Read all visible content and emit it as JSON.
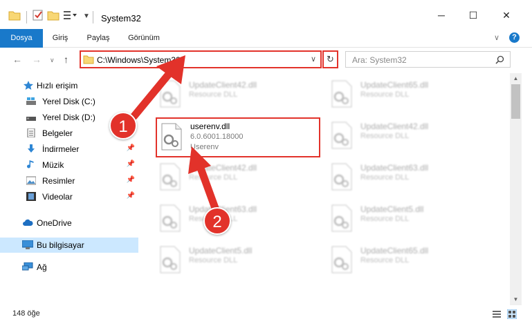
{
  "window": {
    "title": "System32",
    "minimize": "─",
    "maximize": "☐",
    "close": "✕"
  },
  "ribbon": {
    "tabs": [
      {
        "label": "Dosya",
        "active": true
      },
      {
        "label": "Giriş",
        "active": false
      },
      {
        "label": "Paylaş",
        "active": false
      },
      {
        "label": "Görünüm",
        "active": false
      }
    ],
    "help": "?",
    "expand": "∨"
  },
  "address": {
    "path": "C:\\Windows\\System32",
    "dropdown": "∨",
    "refresh": "↻"
  },
  "search": {
    "placeholder": "Ara: System32"
  },
  "sidebar": {
    "items": [
      {
        "label": "Hızlı erişim",
        "icon": "star-icon",
        "pinned": false
      },
      {
        "label": "Yerel Disk (C:)",
        "icon": "drive-icon",
        "pinned": false
      },
      {
        "label": "Yerel Disk (D:)",
        "icon": "drive-icon",
        "pinned": false
      },
      {
        "label": "Belgeler",
        "icon": "document-icon",
        "pinned": true
      },
      {
        "label": "İndirmeler",
        "icon": "download-icon",
        "pinned": true
      },
      {
        "label": "Müzik",
        "icon": "music-icon",
        "pinned": true
      },
      {
        "label": "Resimler",
        "icon": "pictures-icon",
        "pinned": true
      },
      {
        "label": "Videolar",
        "icon": "video-icon",
        "pinned": true
      },
      {
        "label": "OneDrive",
        "icon": "cloud-icon",
        "pinned": false
      },
      {
        "label": "Bu bilgisayar",
        "icon": "computer-icon",
        "pinned": false,
        "selected": true
      },
      {
        "label": "Ağ",
        "icon": "network-icon",
        "pinned": false
      }
    ]
  },
  "files": [
    {
      "name": "UpdateClient42.dll",
      "sub": "Resource DLL",
      "blur": true
    },
    {
      "name": "UpdateClient65.dll",
      "sub": "Resource DLL",
      "blur": true
    },
    {
      "name": "userenv.dll",
      "sub": "6.0.6001.18000",
      "sub2": "Userenv",
      "blur": false
    },
    {
      "name": "UpdateClient42.dll",
      "sub": "Resource DLL",
      "blur": true
    },
    {
      "name": "UpdateClient42.dll",
      "sub": "Resource DLL",
      "blur": true
    },
    {
      "name": "UpdateClient63.dll",
      "sub": "Resource DLL",
      "blur": true
    },
    {
      "name": "UpdateClient63.dll",
      "sub": "Resource DLL",
      "blur": true
    },
    {
      "name": "UpdateClient5.dll",
      "sub": "Resource DLL",
      "blur": true
    },
    {
      "name": "UpdateClient5.dll",
      "sub": "Resource DLL",
      "blur": true
    },
    {
      "name": "UpdateClient65.dll",
      "sub": "Resource DLL",
      "blur": true
    }
  ],
  "status": {
    "count": "148 öğe"
  },
  "annotations": {
    "step1": "1",
    "step2": "2",
    "color": "#e2322a"
  },
  "colors": {
    "accent": "#1979ca",
    "selection": "#cce8ff",
    "highlight": "#e2322a"
  }
}
